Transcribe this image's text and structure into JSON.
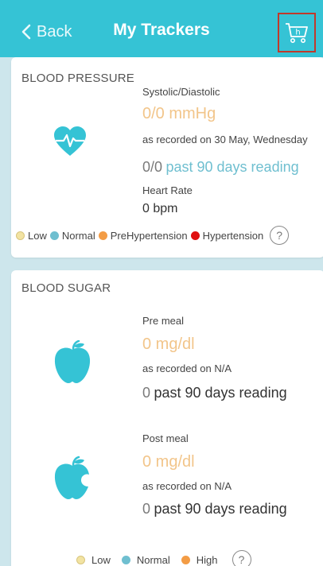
{
  "header": {
    "back_label": "Back",
    "title": "My Trackers",
    "cart_icon": "shopping-cart-icon",
    "cart_letter": "h"
  },
  "colors": {
    "header_bg": "#35c3d5",
    "accent_teal": "#35c3d5",
    "value_orange": "#f2c58a",
    "low": "#f2e3a2",
    "normal": "#6fbfd0",
    "prehypertension": "#f39c45",
    "hypertension": "#e01010",
    "high": "#f39c45"
  },
  "blood_pressure": {
    "title": "BLOOD PRESSURE",
    "icon": "heartbeat-icon",
    "metric_label": "Systolic/Diastolic",
    "value": "0/0 mmHg",
    "recorded": "as recorded on 30 May, Wednesday",
    "past_value": "0/0",
    "past_label": "past 90 days reading",
    "hr_label": "Heart Rate",
    "hr_value": "0 bpm",
    "legend": [
      {
        "label": "Low",
        "color": "#f2e3a2"
      },
      {
        "label": "Normal",
        "color": "#6fbfd0"
      },
      {
        "label": "PreHypertension",
        "color": "#f39c45"
      },
      {
        "label": "Hypertension",
        "color": "#e01010"
      }
    ],
    "help": "?"
  },
  "blood_sugar": {
    "title": "BLOOD SUGAR",
    "pre": {
      "icon": "apple-icon",
      "label": "Pre meal",
      "value": "0 mg/dl",
      "recorded": "as recorded on N/A",
      "past_value": "0",
      "past_label": "past 90 days reading"
    },
    "post": {
      "icon": "bitten-apple-icon",
      "label": "Post meal",
      "value": "0 mg/dl",
      "recorded": "as recorded on N/A",
      "past_value": "0",
      "past_label": "past 90 days reading"
    },
    "legend": [
      {
        "label": "Low",
        "color": "#f2e3a2"
      },
      {
        "label": "Normal",
        "color": "#6fbfd0"
      },
      {
        "label": "High",
        "color": "#f39c45"
      }
    ],
    "help": "?"
  }
}
